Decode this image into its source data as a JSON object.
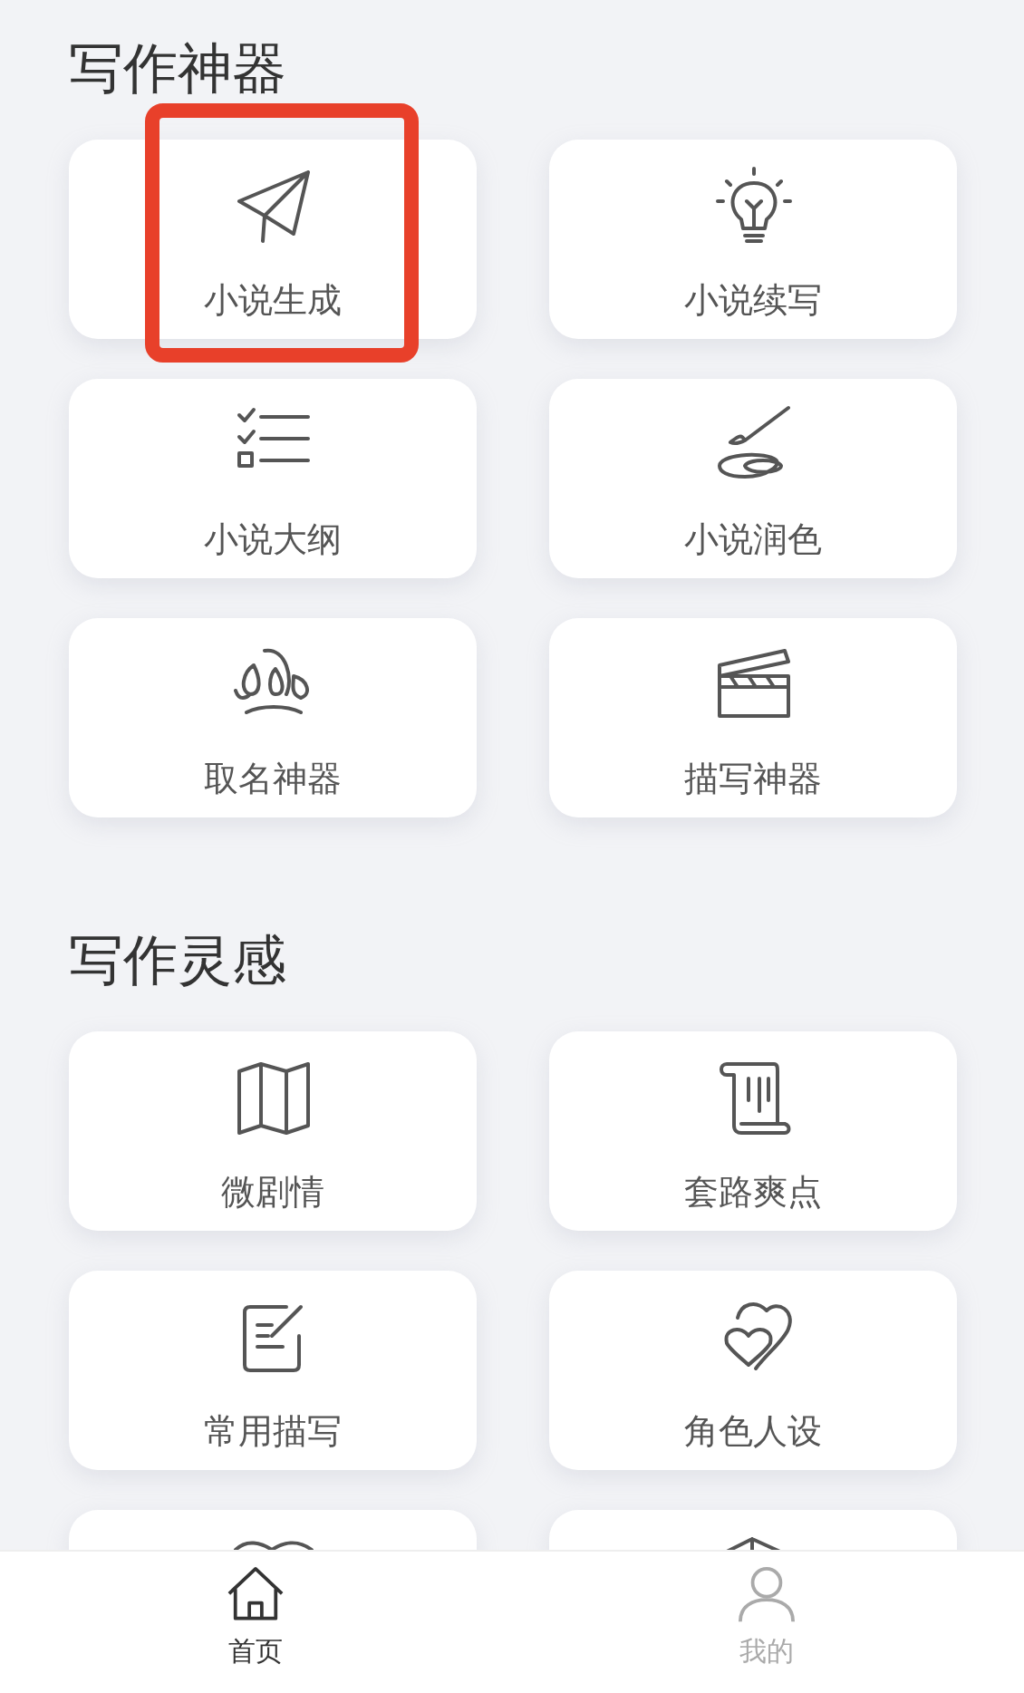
{
  "sections": [
    {
      "title": "写作神器",
      "cards": [
        {
          "label": "小说生成",
          "highlighted": true
        },
        {
          "label": "小说续写",
          "highlighted": false
        },
        {
          "label": "小说大纲",
          "highlighted": false
        },
        {
          "label": "小说润色",
          "highlighted": false
        },
        {
          "label": "取名神器",
          "highlighted": false
        },
        {
          "label": "描写神器",
          "highlighted": false
        }
      ]
    },
    {
      "title": "写作灵感",
      "cards": [
        {
          "label": "微剧情",
          "highlighted": false
        },
        {
          "label": "套路爽点",
          "highlighted": false
        },
        {
          "label": "常用描写",
          "highlighted": false
        },
        {
          "label": "角色人设",
          "highlighted": false
        },
        {
          "highlighted": false
        },
        {
          "highlighted": false
        }
      ]
    }
  ],
  "tabs": [
    {
      "label": "首页",
      "selected": true
    },
    {
      "label": "我的",
      "selected": false
    }
  ]
}
